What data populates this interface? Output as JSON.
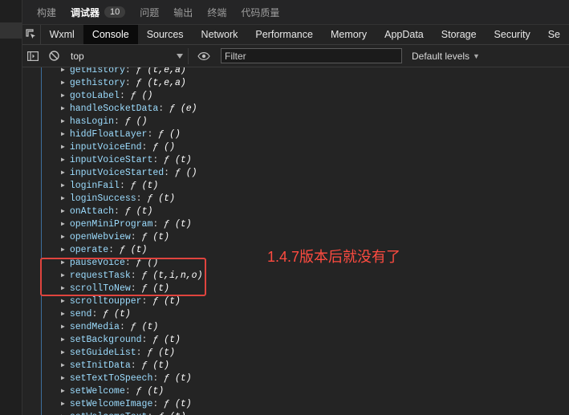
{
  "panel_tabs": [
    {
      "label": "构建",
      "active": false
    },
    {
      "label": "调试器",
      "active": true,
      "badge": "10"
    },
    {
      "label": "问题",
      "active": false
    },
    {
      "label": "输出",
      "active": false
    },
    {
      "label": "终端",
      "active": false
    },
    {
      "label": "代码质量",
      "active": false
    }
  ],
  "devtools_tabs": [
    {
      "label": "Wxml",
      "active": false
    },
    {
      "label": "Console",
      "active": true
    },
    {
      "label": "Sources",
      "active": false
    },
    {
      "label": "Network",
      "active": false
    },
    {
      "label": "Performance",
      "active": false
    },
    {
      "label": "Memory",
      "active": false
    },
    {
      "label": "AppData",
      "active": false
    },
    {
      "label": "Storage",
      "active": false
    },
    {
      "label": "Security",
      "active": false
    },
    {
      "label": "Se",
      "active": false
    }
  ],
  "toolbar": {
    "context": "top",
    "filter_placeholder": "Filter",
    "levels": "Default levels"
  },
  "console_rows": [
    {
      "key": "getHistory",
      "sig": "ƒ (t,e,a)"
    },
    {
      "key": "gethistory",
      "sig": "ƒ (t,e,a)"
    },
    {
      "key": "gotoLabel",
      "sig": "ƒ ()"
    },
    {
      "key": "handleSocketData",
      "sig": "ƒ (e)"
    },
    {
      "key": "hasLogin",
      "sig": "ƒ ()"
    },
    {
      "key": "hiddFloatLayer",
      "sig": "ƒ ()"
    },
    {
      "key": "inputVoiceEnd",
      "sig": "ƒ ()"
    },
    {
      "key": "inputVoiceStart",
      "sig": "ƒ (t)"
    },
    {
      "key": "inputVoiceStarted",
      "sig": "ƒ ()"
    },
    {
      "key": "loginFail",
      "sig": "ƒ (t)"
    },
    {
      "key": "loginSuccess",
      "sig": "ƒ (t)"
    },
    {
      "key": "onAttach",
      "sig": "ƒ (t)"
    },
    {
      "key": "openMiniProgram",
      "sig": "ƒ (t)"
    },
    {
      "key": "openWebview",
      "sig": "ƒ (t)"
    },
    {
      "key": "operate",
      "sig": "ƒ (t)"
    },
    {
      "key": "pauseVoice",
      "sig": "ƒ ()"
    },
    {
      "key": "requestTask",
      "sig": "ƒ (t,i,n,o)"
    },
    {
      "key": "scrollToNew",
      "sig": "ƒ (t)"
    },
    {
      "key": "scrolltoupper",
      "sig": "ƒ (t)"
    },
    {
      "key": "send",
      "sig": "ƒ (t)"
    },
    {
      "key": "sendMedia",
      "sig": "ƒ (t)"
    },
    {
      "key": "setBackground",
      "sig": "ƒ (t)"
    },
    {
      "key": "setGuideList",
      "sig": "ƒ (t)"
    },
    {
      "key": "setInitData",
      "sig": "ƒ (t)"
    },
    {
      "key": "setTextToSpeech",
      "sig": "ƒ (t)"
    },
    {
      "key": "setWelcome",
      "sig": "ƒ (t)"
    },
    {
      "key": "setWelcomeImage",
      "sig": "ƒ (t)"
    },
    {
      "key": "setWelcomeText",
      "sig": "ƒ (t)"
    }
  ],
  "annotation": "1.4.7版本后就没有了",
  "colors": {
    "key": "#9cdcfe",
    "annotation": "#ff4b40",
    "highlight_box": "#e0443e",
    "active_tab_bg": "#0b0b0b"
  }
}
